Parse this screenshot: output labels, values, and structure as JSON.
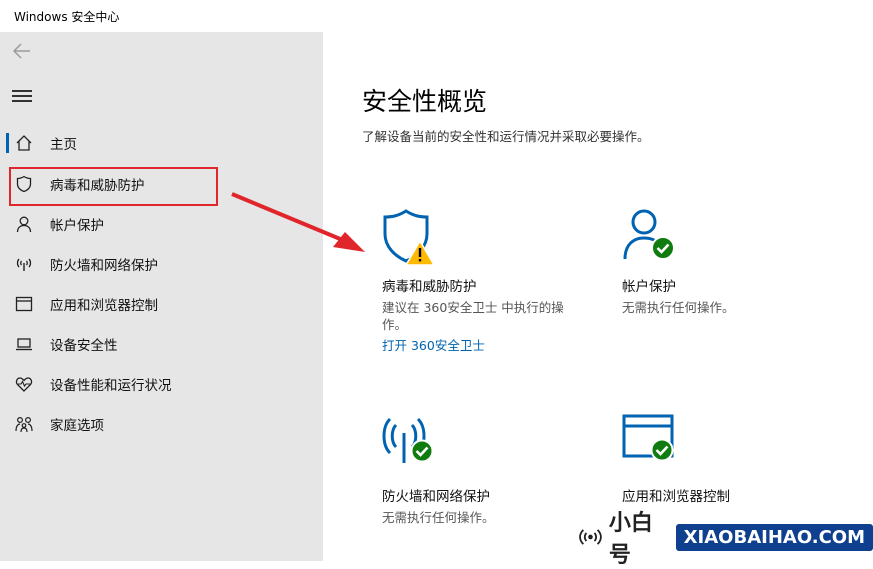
{
  "window": {
    "title": "Windows 安全中心"
  },
  "sidebar": {
    "items": [
      {
        "label": "主页",
        "icon": "home-icon"
      },
      {
        "label": "病毒和威胁防护",
        "icon": "shield-icon"
      },
      {
        "label": "帐户保护",
        "icon": "person-icon"
      },
      {
        "label": "防火墙和网络保护",
        "icon": "wifi-antenna-icon"
      },
      {
        "label": "应用和浏览器控制",
        "icon": "browser-window-icon"
      },
      {
        "label": "设备安全性",
        "icon": "laptop-icon"
      },
      {
        "label": "设备性能和运行状况",
        "icon": "heart-pulse-icon"
      },
      {
        "label": "家庭选项",
        "icon": "family-icon"
      }
    ],
    "selected_index": 0
  },
  "main": {
    "title": "安全性概览",
    "subtitle": "了解设备当前的安全性和运行情况并采取必要操作。",
    "cards": [
      {
        "title": "病毒和威胁防护",
        "desc": "建议在 360安全卫士 中执行的操作。",
        "link": "打开 360安全卫士",
        "status": "warning"
      },
      {
        "title": "帐户保护",
        "desc": "无需执行任何操作。",
        "status": "ok"
      },
      {
        "title": "防火墙和网络保护",
        "desc": "无需执行任何操作。",
        "status": "ok"
      },
      {
        "title": "应用和浏览器控制",
        "desc": "",
        "status": "ok"
      }
    ]
  },
  "brand": {
    "text": "小白号",
    "url": "XIAOBAIHAO.COM"
  },
  "colors": {
    "accent": "#0063b1",
    "ok": "#107c10",
    "warn": "#ffb900",
    "annotation": "#e0262b",
    "sidebar_bg": "#e6e6e6"
  }
}
